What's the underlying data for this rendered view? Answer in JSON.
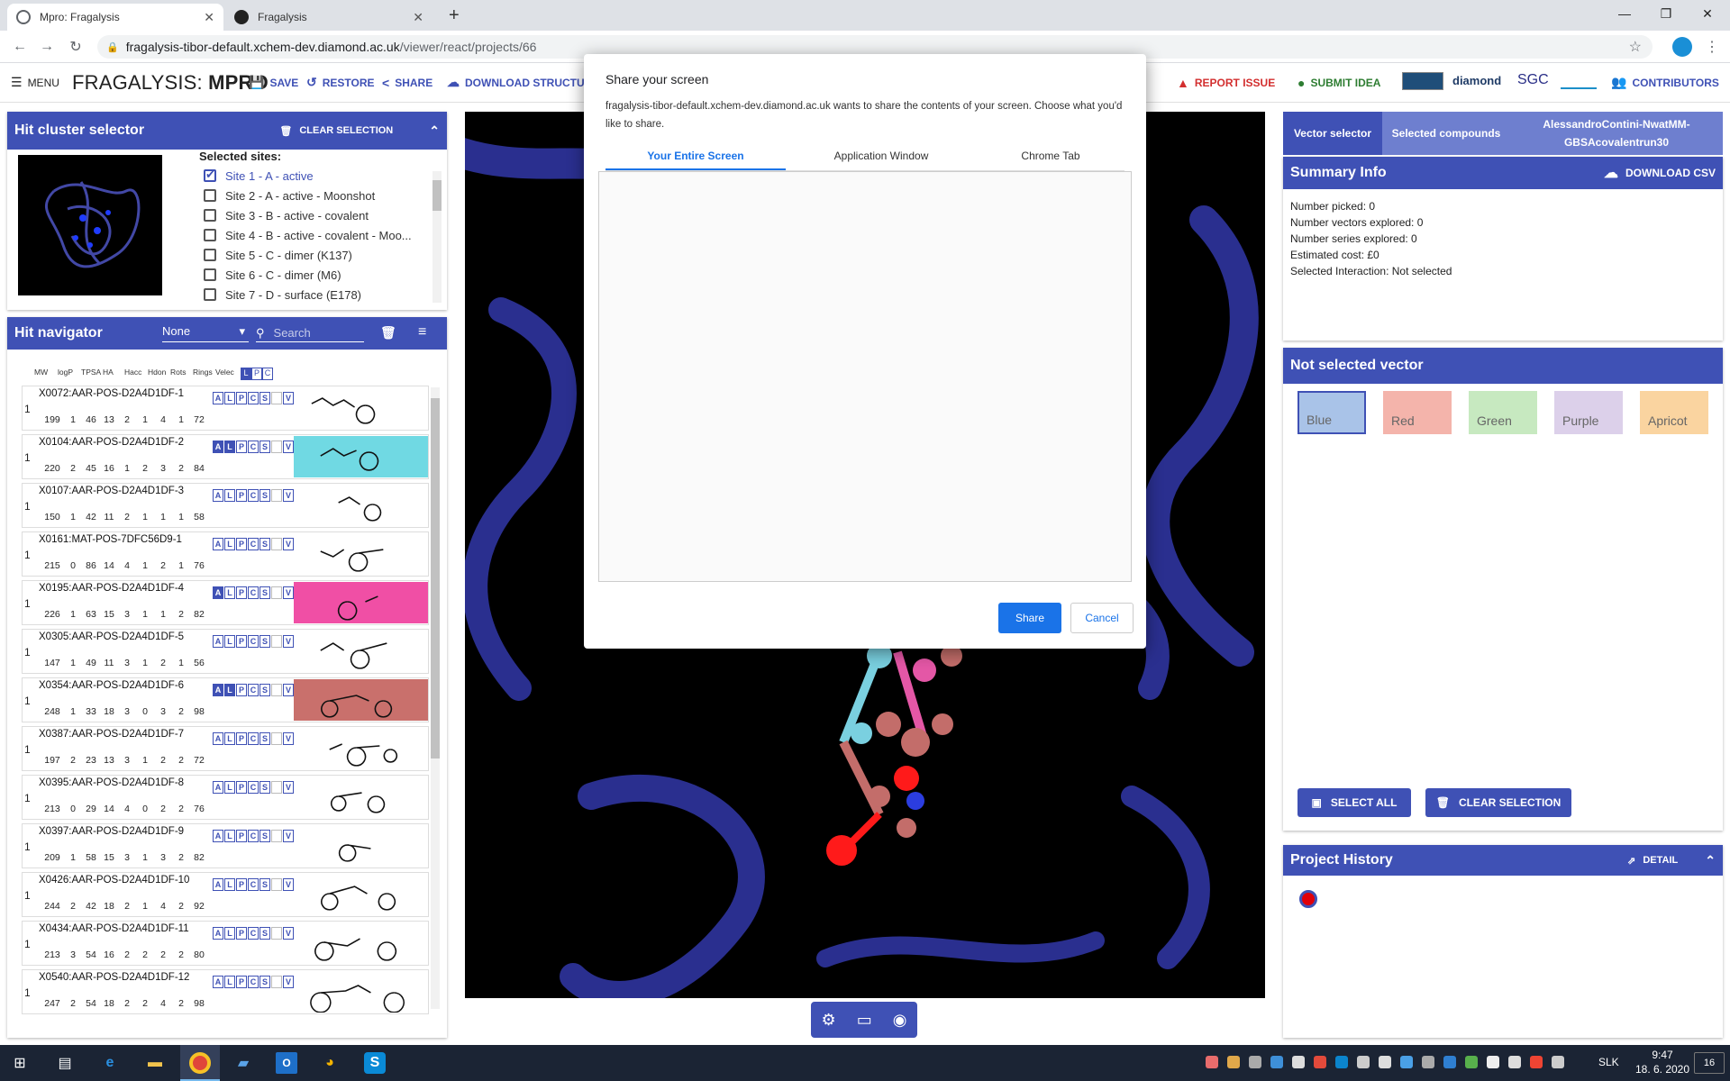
{
  "browser": {
    "tabs": [
      {
        "title": "Mpro: Fragalysis",
        "active": true
      },
      {
        "title": "Fragalysis",
        "active": false
      }
    ],
    "new_tab": "+",
    "url_host": "fragalysis-tibor-default.xchem-dev.diamond.ac.uk",
    "url_path": "/viewer/react/projects/66"
  },
  "app": {
    "menu": "MENU",
    "brand_prefix": "FRAGALYSIS: ",
    "brand_target": "MPRO",
    "toolbar": {
      "save": "SAVE",
      "restore": "RESTORE",
      "share": "SHARE",
      "download": "DOWNLOAD STRUCTUR",
      "report_issue": "REPORT ISSUE",
      "submit_idea": "SUBMIT IDEA",
      "contributors": "CONTRIBUTORS"
    },
    "logos": [
      "diamond",
      "SGC"
    ]
  },
  "hit_cluster": {
    "title": "Hit cluster selector",
    "clear": "CLEAR SELECTION",
    "selected_sites_label": "Selected sites:",
    "sites": [
      {
        "label": "Site 1 - A - active",
        "checked": true
      },
      {
        "label": "Site 2 - A - active - Moonshot",
        "checked": false
      },
      {
        "label": "Site 3 - B - active - covalent",
        "checked": false
      },
      {
        "label": "Site 4 - B - active - covalent - Moo...",
        "checked": false
      },
      {
        "label": "Site 5 - C - dimer (K137)",
        "checked": false
      },
      {
        "label": "Site 6 - C - dimer (M6)",
        "checked": false
      },
      {
        "label": "Site 7 - D - surface (E178)",
        "checked": false
      }
    ]
  },
  "hit_nav": {
    "title": "Hit navigator",
    "filter_value": "None",
    "search_placeholder": "Search",
    "columns": [
      "MW",
      "logP",
      "TPSA",
      "HA",
      "Hacc",
      "Hdon",
      "Rots",
      "Rings",
      "Velec"
    ],
    "lpc": [
      "L",
      "P",
      "C"
    ],
    "row_buttons": [
      "A",
      "L",
      "P",
      "C",
      "S",
      "",
      "V"
    ],
    "hits": [
      {
        "name": "X0072:AAR-POS-D2A4D1DF-1",
        "count": "1",
        "props": [
          "199",
          "1",
          "46",
          "13",
          "2",
          "1",
          "4",
          "1",
          "72"
        ],
        "active": [],
        "bg": ""
      },
      {
        "name": "X0104:AAR-POS-D2A4D1DF-2",
        "count": "1",
        "props": [
          "220",
          "2",
          "45",
          "16",
          "1",
          "2",
          "3",
          "2",
          "84"
        ],
        "active": [
          "A",
          "L"
        ],
        "bg": "#70d9e3"
      },
      {
        "name": "X0107:AAR-POS-D2A4D1DF-3",
        "count": "1",
        "props": [
          "150",
          "1",
          "42",
          "11",
          "2",
          "1",
          "1",
          "1",
          "58"
        ],
        "active": [],
        "bg": ""
      },
      {
        "name": "X0161:MAT-POS-7DFC56D9-1",
        "count": "1",
        "props": [
          "215",
          "0",
          "86",
          "14",
          "4",
          "1",
          "2",
          "1",
          "76"
        ],
        "active": [],
        "bg": ""
      },
      {
        "name": "X0195:AAR-POS-D2A4D1DF-4",
        "count": "1",
        "props": [
          "226",
          "1",
          "63",
          "15",
          "3",
          "1",
          "1",
          "2",
          "82"
        ],
        "active": [
          "A"
        ],
        "bg": "#f04fa5"
      },
      {
        "name": "X0305:AAR-POS-D2A4D1DF-5",
        "count": "1",
        "props": [
          "147",
          "1",
          "49",
          "11",
          "3",
          "1",
          "2",
          "1",
          "56"
        ],
        "active": [],
        "bg": ""
      },
      {
        "name": "X0354:AAR-POS-D2A4D1DF-6",
        "count": "1",
        "props": [
          "248",
          "1",
          "33",
          "18",
          "3",
          "0",
          "3",
          "2",
          "98"
        ],
        "active": [
          "A",
          "L"
        ],
        "bg": "#c9706c"
      },
      {
        "name": "X0387:AAR-POS-D2A4D1DF-7",
        "count": "1",
        "props": [
          "197",
          "2",
          "23",
          "13",
          "3",
          "1",
          "2",
          "2",
          "72"
        ],
        "active": [],
        "bg": ""
      },
      {
        "name": "X0395:AAR-POS-D2A4D1DF-8",
        "count": "1",
        "props": [
          "213",
          "0",
          "29",
          "14",
          "4",
          "0",
          "2",
          "2",
          "76"
        ],
        "active": [],
        "bg": ""
      },
      {
        "name": "X0397:AAR-POS-D2A4D1DF-9",
        "count": "1",
        "props": [
          "209",
          "1",
          "58",
          "15",
          "3",
          "1",
          "3",
          "2",
          "82"
        ],
        "active": [],
        "bg": ""
      },
      {
        "name": "X0426:AAR-POS-D2A4D1DF-10",
        "count": "1",
        "props": [
          "244",
          "2",
          "42",
          "18",
          "2",
          "1",
          "4",
          "2",
          "92"
        ],
        "active": [],
        "bg": ""
      },
      {
        "name": "X0434:AAR-POS-D2A4D1DF-11",
        "count": "1",
        "props": [
          "213",
          "3",
          "54",
          "16",
          "2",
          "2",
          "2",
          "2",
          "80"
        ],
        "active": [],
        "bg": ""
      },
      {
        "name": "X0540:AAR-POS-D2A4D1DF-12",
        "count": "1",
        "props": [
          "247",
          "2",
          "54",
          "18",
          "2",
          "2",
          "4",
          "2",
          "98"
        ],
        "active": [],
        "bg": ""
      }
    ]
  },
  "right": {
    "tabs": [
      "Vector selector",
      "Selected compounds",
      "AlessandroContini-NwatMM-GBSAcovalentrun30"
    ],
    "summary": {
      "title": "Summary Info",
      "download": "DOWNLOAD CSV",
      "lines": [
        "Number picked: 0",
        "Number vectors explored: 0",
        "Number series explored: 0",
        "Estimated cost: £0",
        "Selected Interaction: Not selected"
      ]
    },
    "vector": {
      "title": "Not selected vector",
      "colors": [
        {
          "label": "Blue",
          "bg": "#a9c3e8",
          "selected": true
        },
        {
          "label": "Red",
          "bg": "#f4b4ab",
          "selected": false
        },
        {
          "label": "Green",
          "bg": "#c7e9c0",
          "selected": false
        },
        {
          "label": "Purple",
          "bg": "#dcd0ea",
          "selected": false
        },
        {
          "label": "Apricot",
          "bg": "#fad4a0",
          "selected": false
        }
      ],
      "select_all": "SELECT ALL",
      "clear": "CLEAR SELECTION"
    },
    "history": {
      "title": "Project History",
      "detail": "DETAIL"
    }
  },
  "dialog": {
    "title": "Share your screen",
    "message": "fragalysis-tibor-default.xchem-dev.diamond.ac.uk wants to share the contents of your screen. Choose what you'd like to share.",
    "tabs": [
      "Your Entire Screen",
      "Application Window",
      "Chrome Tab"
    ],
    "share": "Share",
    "cancel": "Cancel"
  },
  "taskbar": {
    "lang": "SLK",
    "time": "9:47",
    "date": "18. 6. 2020",
    "notifications": "16"
  }
}
